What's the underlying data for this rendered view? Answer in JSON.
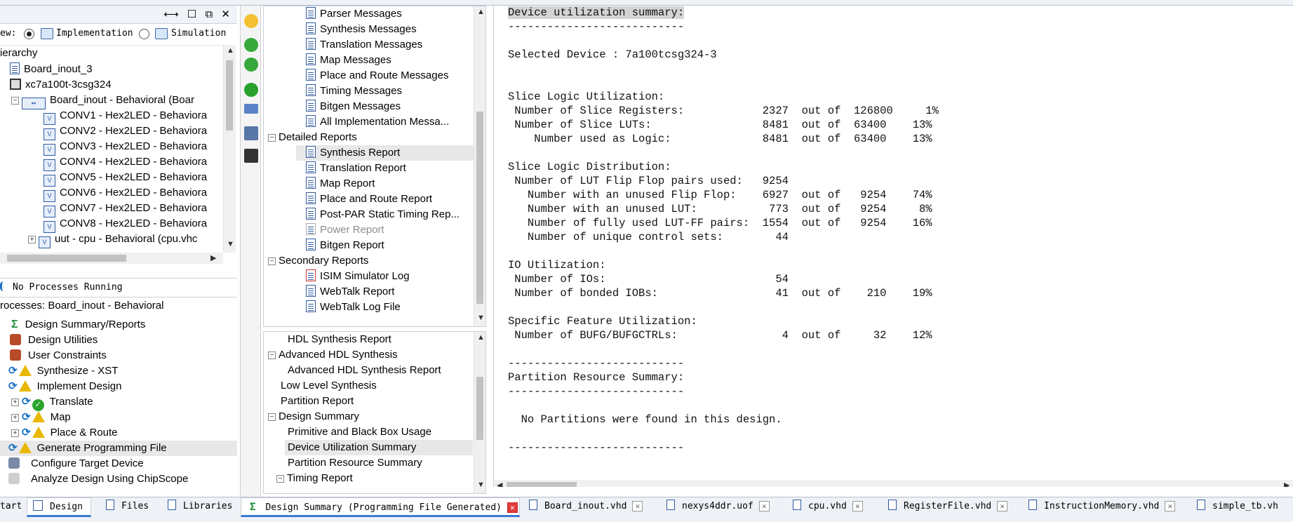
{
  "left": {
    "panel_buttons": "⟷ ☐ ⧉ ✕",
    "view_label": "ew:",
    "view_impl": "Implementation",
    "view_sim": "Simulation",
    "hierarchy_title": "ierarchy",
    "hierarchy": [
      "Board_inout_3",
      "xc7a100t-3csg324",
      "Board_inout - Behavioral (Boar",
      "CONV1 - Hex2LED - Behaviora",
      "CONV2 - Hex2LED - Behaviora",
      "CONV3 - Hex2LED - Behaviora",
      "CONV4 - Hex2LED - Behaviora",
      "CONV5 - Hex2LED - Behaviora",
      "CONV6 - Hex2LED - Behaviora",
      "CONV7 - Hex2LED - Behaviora",
      "CONV8 - Hex2LED - Behaviora",
      "uut - cpu - Behavioral (cpu.vhc"
    ],
    "status": "No Processes Running",
    "processes_title": "rocesses: Board_inout - Behavioral",
    "processes": [
      "Design Summary/Reports",
      "Design Utilities",
      "User Constraints",
      "Synthesize - XST",
      "Implement Design",
      "Translate",
      "Map",
      "Place & Route",
      "Generate Programming File",
      "Configure Target Device",
      "Analyze Design Using ChipScope"
    ]
  },
  "mid1": [
    "Parser Messages",
    "Synthesis Messages",
    "Translation Messages",
    "Map Messages",
    "Place and Route Messages",
    "Timing Messages",
    "Bitgen Messages",
    "All Implementation Messa...",
    "Detailed Reports",
    "Synthesis Report",
    "Translation Report",
    "Map Report",
    "Place and Route Report",
    "Post-PAR Static Timing Rep...",
    "Power Report",
    "Bitgen Report",
    "Secondary Reports",
    "ISIM Simulator Log",
    "WebTalk Report",
    "WebTalk Log File"
  ],
  "mid2": [
    "HDL Synthesis Report",
    "Advanced HDL Synthesis",
    "Advanced HDL Synthesis Report",
    "Low Level Synthesis",
    "Partition Report",
    "Design Summary",
    "Primitive and Black Box Usage",
    "Device Utilization Summary",
    "Partition Resource Summary",
    "Timing Report"
  ],
  "report": {
    "lines": [
      "Device utilization summary:",
      "---------------------------",
      "",
      "Selected Device : 7a100tcsg324-3",
      "",
      "",
      "Slice Logic Utilization:",
      " Number of Slice Registers:            2327  out of  126800     1%",
      " Number of Slice LUTs:                 8481  out of  63400    13%",
      "    Number used as Logic:              8481  out of  63400    13%",
      "",
      "Slice Logic Distribution:",
      " Number of LUT Flip Flop pairs used:   9254",
      "   Number with an unused Flip Flop:    6927  out of   9254    74%",
      "   Number with an unused LUT:           773  out of   9254     8%",
      "   Number of fully used LUT-FF pairs:  1554  out of   9254    16%",
      "   Number of unique control sets:        44",
      "",
      "IO Utilization:",
      " Number of IOs:                          54",
      " Number of bonded IOBs:                  41  out of    210    19%",
      "",
      "Specific Feature Utilization:",
      " Number of BUFG/BUFGCTRLs:                4  out of     32    12%",
      "",
      "---------------------------",
      "Partition Resource Summary:",
      "---------------------------",
      "",
      "  No Partitions were found in this design.",
      "",
      "---------------------------"
    ]
  },
  "tabs": {
    "left": [
      "tart",
      "Design",
      "Files",
      "Libraries"
    ],
    "docs": [
      "Design Summary (Programming File Generated)",
      "Board_inout.vhd",
      "nexys4ddr.uof",
      "cpu.vhd",
      "RegisterFile.vhd",
      "InstructionMemory.vhd",
      "simple_tb.vh"
    ]
  }
}
